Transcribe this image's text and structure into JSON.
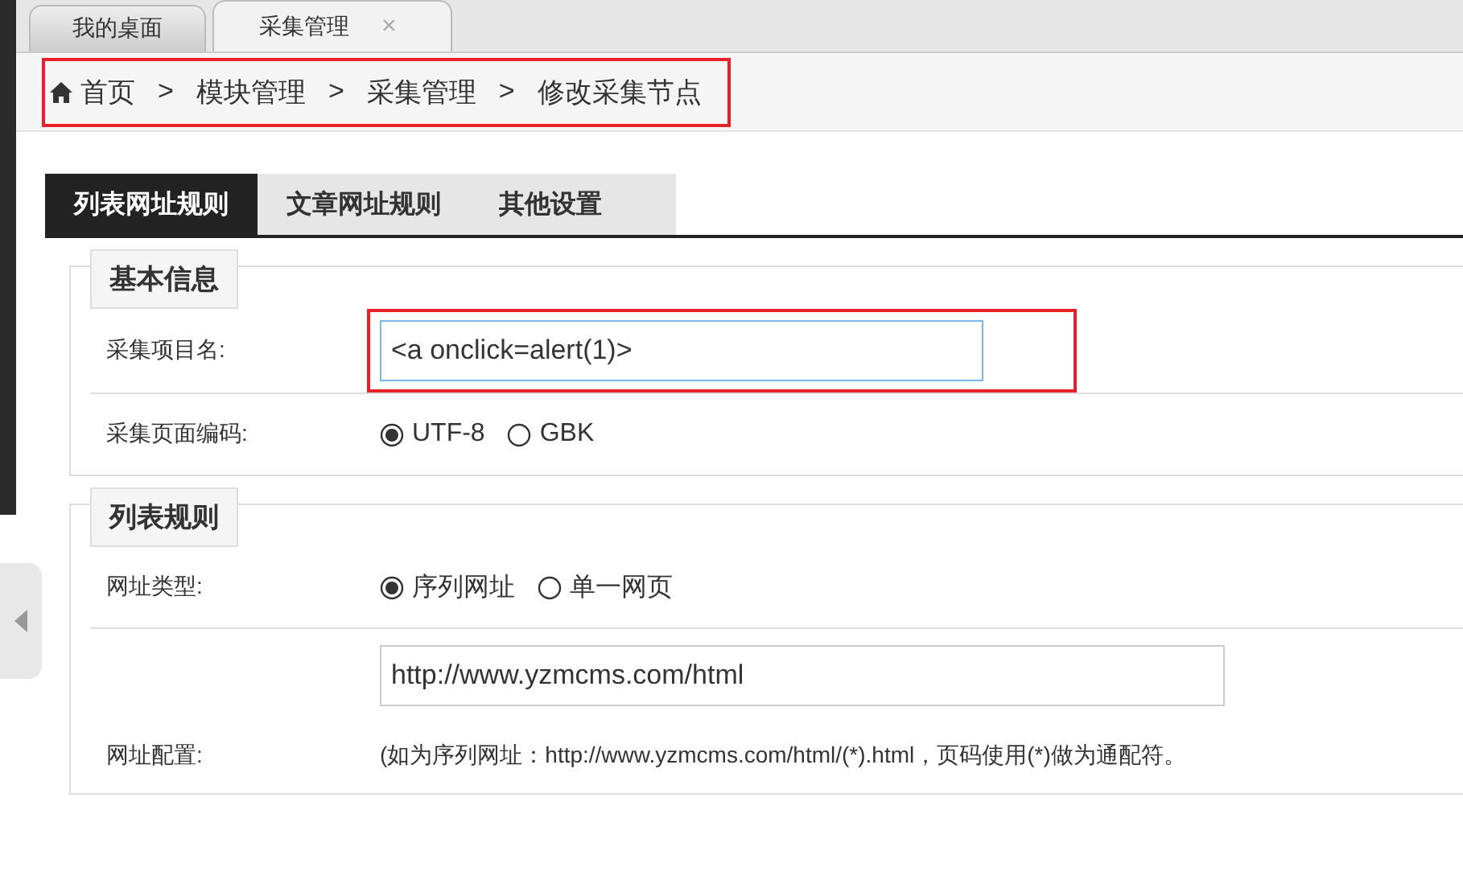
{
  "window_tabs": [
    {
      "label": "我的桌面",
      "selected": false
    },
    {
      "label": "采集管理",
      "selected": true,
      "close": "×"
    }
  ],
  "breadcrumb": {
    "annotated": true,
    "items": [
      {
        "kind": "home",
        "label": "首页"
      },
      {
        "kind": "sep",
        "label": ">"
      },
      {
        "kind": "link",
        "label": "模块管理"
      },
      {
        "kind": "sep",
        "label": ">"
      },
      {
        "kind": "link",
        "label": "采集管理"
      },
      {
        "kind": "sep",
        "label": ">"
      },
      {
        "kind": "link",
        "label": "修改采集节点"
      }
    ]
  },
  "tabs": [
    {
      "label": "列表网址规则",
      "selected": true
    },
    {
      "label": "文章网址规则",
      "selected": false
    },
    {
      "label": "其他设置",
      "selected": false
    }
  ],
  "sections": [
    {
      "title": "基本信息",
      "rows": [
        {
          "kind": "text",
          "label": "采集项目名:",
          "value": "<a onclick=alert(1)>",
          "annotated": true,
          "focused": true
        },
        {
          "kind": "radio",
          "label": "采集页面编码:",
          "options": [
            {
              "label": "UTF-8",
              "selected": true
            },
            {
              "label": "GBK",
              "selected": false
            }
          ]
        }
      ]
    },
    {
      "title": "列表规则",
      "rows": [
        {
          "kind": "radio",
          "label": "网址类型:",
          "options": [
            {
              "label": "序列网址",
              "selected": true
            },
            {
              "label": "单一网页",
              "selected": false
            }
          ]
        },
        {
          "kind": "url",
          "label": "网址配置:",
          "value": "http://www.yzmcms.com/html",
          "hint": "(如为序列网址：http://www.yzmcms.com/html/(*).html，页码使用(*)做为通配符。"
        }
      ]
    }
  ]
}
